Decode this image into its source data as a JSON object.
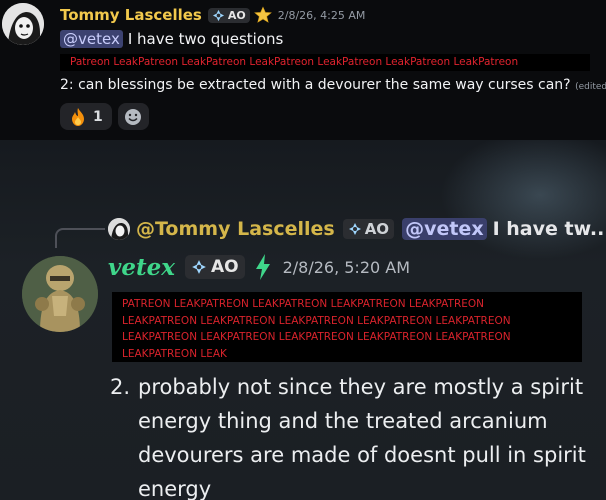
{
  "message1": {
    "username": "Tommy Lascelles",
    "tag": "AO",
    "timestamp": "2/8/26, 4:25 AM",
    "mention": "@vetex",
    "line1": "I have two questions",
    "redacted_banner": "Patreon LeakPatreon LeakPatreon LeakPatreon LeakPatreon LeakPatreon LeakPatreon",
    "line2": "2: can blessings be extracted with a devourer the same way curses can?",
    "edited": "(edited)",
    "reactions": [
      {
        "emoji": "🔥",
        "count": "1"
      }
    ]
  },
  "message2": {
    "reply": {
      "username": "@Tommy Lascelles",
      "tag": "AO",
      "mention": "@vetex",
      "preview": "I have tw..."
    },
    "username": "vetex",
    "tag": "AO",
    "timestamp": "2/8/26, 5:20 AM",
    "redacted_lines": [
      "PATREON LEAKPATREON LEAKPATREON LEAKPATREON LEAKPATREON",
      "LEAKPATREON LEAKPATREON LEAKPATREON LEAKPATREON LEAKPATREON",
      "LEAKPATREON LEAKPATREON LEAKPATREON LEAKPATREON LEAKPATREON",
      "LEAKPATREON LEAK"
    ],
    "list_number": "2.",
    "answer": "probably not since they are mostly a spirit energy thing and the treated arcanium devourers are made of doesnt pull in spirit energy"
  },
  "colors": {
    "username1": "#f2c94c",
    "username2": "#3fd68a",
    "mention_bg": "#3c4270",
    "redact_text": "#e0232e"
  },
  "icons": [
    "ao-badge-icon",
    "star-icon",
    "fire-emoji",
    "add-reaction-icon",
    "lightning-icon"
  ]
}
